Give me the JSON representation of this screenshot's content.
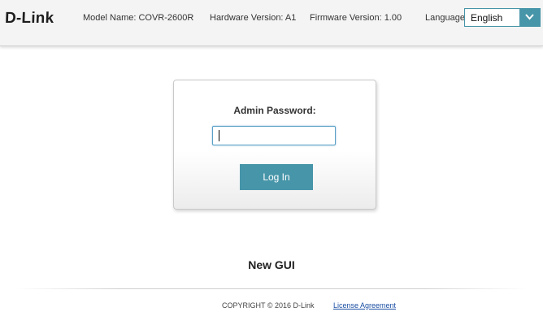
{
  "header": {
    "logo_text": "D-Link",
    "model": "Model Name: COVR-2600R",
    "hardware": "Hardware Version: A1",
    "firmware": "Firmware Version: 1.00",
    "language_label": "Language:",
    "language_value": "English",
    "language_icon": "chevron-down-icon"
  },
  "login": {
    "password_label": "Admin Password:",
    "password_value": "",
    "login_button": "Log In"
  },
  "main": {
    "new_gui_label": "New GUI"
  },
  "footer": {
    "copyright": "COPYRIGHT © 2016 D-Link",
    "license_link": "License Agreement"
  },
  "colors": {
    "accent": "#4795a9",
    "link": "#1b4fa3"
  }
}
